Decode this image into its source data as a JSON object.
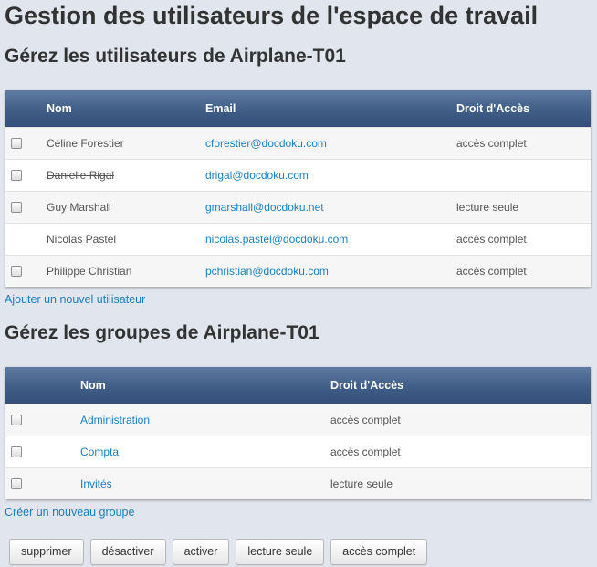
{
  "page": {
    "title": "Gestion des utilisateurs de l'espace de travail"
  },
  "users": {
    "heading": "Gérez les utilisateurs de Airplane-T01",
    "columns": {
      "name": "Nom",
      "email": "Email",
      "access": "Droit d'Accès"
    },
    "rows": [
      {
        "name": "Céline Forestier",
        "email": "cforestier@docdoku.com",
        "access": "accès complet",
        "checkbox": true,
        "disabled": false
      },
      {
        "name": "Danielle Rigal",
        "email": "drigal@docdoku.com",
        "access": "",
        "checkbox": true,
        "disabled": true
      },
      {
        "name": "Guy Marshall",
        "email": "gmarshall@docdoku.net",
        "access": "lecture seule",
        "checkbox": true,
        "disabled": false
      },
      {
        "name": "Nicolas Pastel",
        "email": "nicolas.pastel@docdoku.com",
        "access": "accès complet",
        "checkbox": false,
        "disabled": false
      },
      {
        "name": "Philippe Christian",
        "email": "pchristian@docdoku.com",
        "access": "accès complet",
        "checkbox": true,
        "disabled": false
      }
    ],
    "add_link": "Ajouter un nouvel utilisateur"
  },
  "groups": {
    "heading": "Gérez les groupes de Airplane-T01",
    "columns": {
      "name": "Nom",
      "access": "Droit d'Accès"
    },
    "rows": [
      {
        "name": "Administration",
        "access": "accès complet"
      },
      {
        "name": "Compta",
        "access": "accès complet"
      },
      {
        "name": "Invités",
        "access": "lecture seule"
      }
    ],
    "add_link": "Créer un nouveau groupe"
  },
  "actions": {
    "delete": "supprimer",
    "deactivate": "désactiver",
    "activate": "activer",
    "read_only": "lecture seule",
    "full_access": "accès complet"
  }
}
